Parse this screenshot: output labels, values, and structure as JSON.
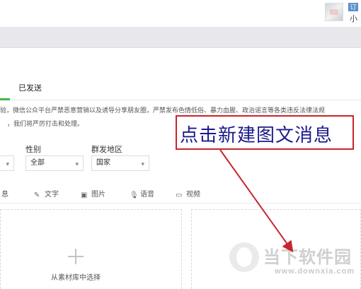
{
  "header": {
    "badge": "订",
    "username": "小"
  },
  "tabs": {
    "sent": "已发送"
  },
  "notice": {
    "line1": "验，微信公众平台严禁恶意营销以及诱导分享朋友圈，严禁发布色情低俗、暴力血腥、政治谣言等各类违反法律法规",
    "line2": "，我们将严厉打击和处理。"
  },
  "filters": {
    "gender_label": "性别",
    "gender_value": "全部",
    "region_label": "群发地区",
    "region_value": "国家"
  },
  "message_types": {
    "partial_news": "息",
    "text": "文字",
    "image": "图片",
    "voice": "语音",
    "video": "视频"
  },
  "library": {
    "select_label": "从素材库中选择"
  },
  "annotation": {
    "text": "点击新建图文消息",
    "color": "#c8252c"
  },
  "watermark": {
    "brand": "当下软件园",
    "url": "www.downxia.com"
  },
  "colors": {
    "accent": "#44b549",
    "annotation_text": "#1a1a8c"
  }
}
